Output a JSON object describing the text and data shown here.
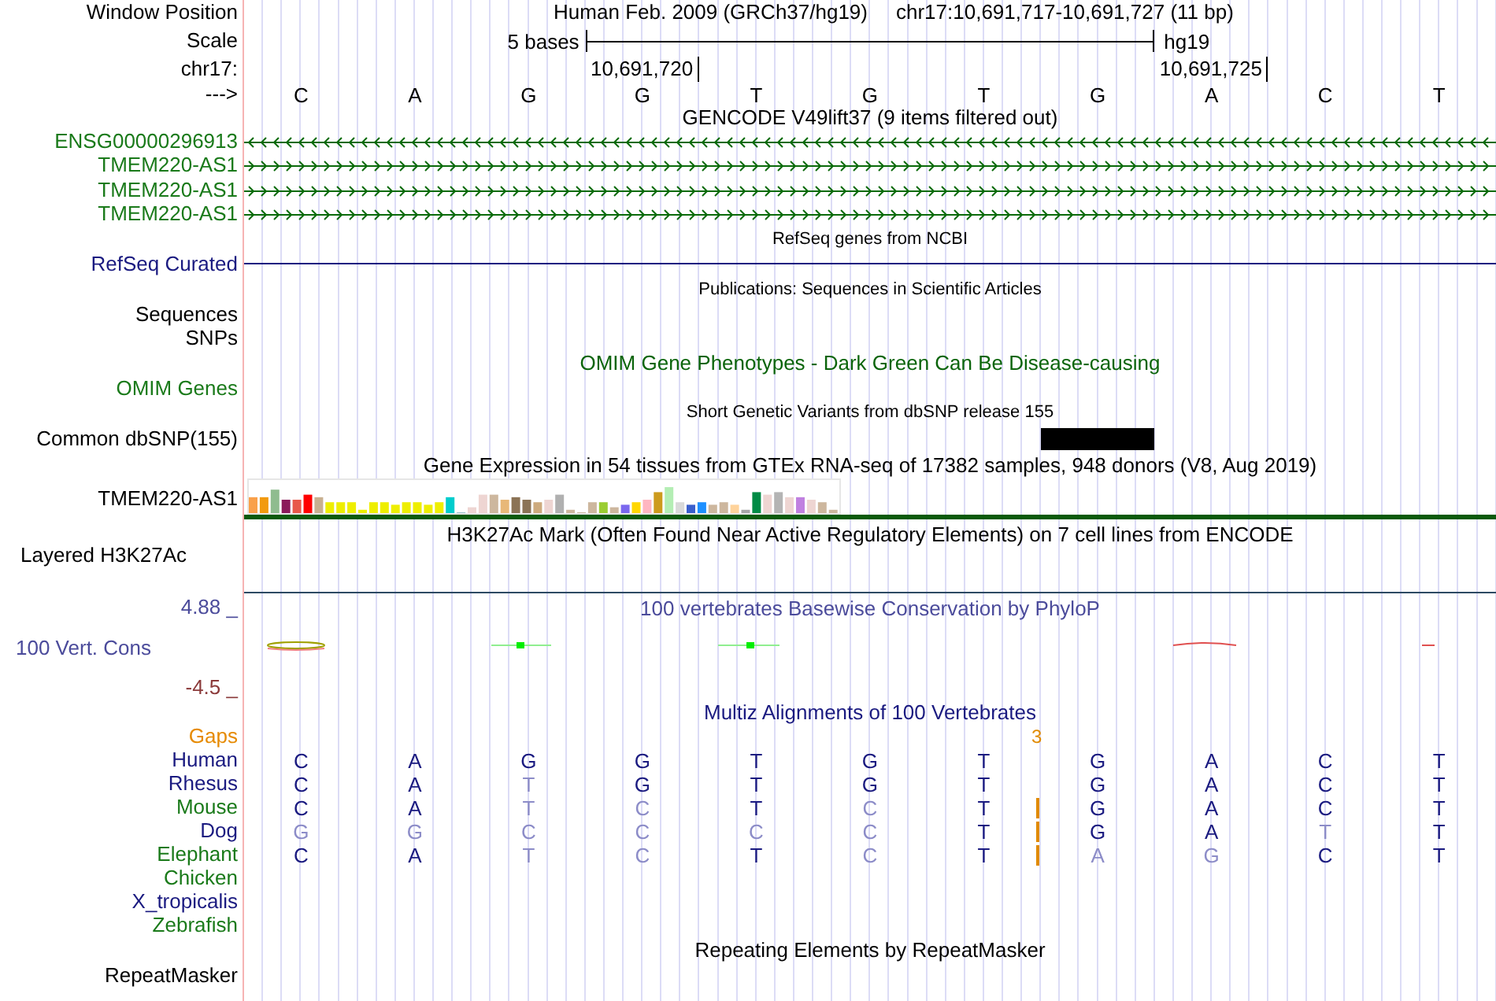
{
  "header": {
    "label": "Window Position",
    "title": "Human Feb. 2009 (GRCh37/hg19)",
    "position": "chr17:10,691,717-10,691,727 (11 bp)"
  },
  "scale": {
    "label": "Scale",
    "span": "5 bases",
    "assembly": "hg19"
  },
  "coordinates": {
    "label": "chr17:",
    "ticks": [
      "10,691,720",
      "10,691,725"
    ]
  },
  "sequence": {
    "label": "--->",
    "bases": [
      "C",
      "A",
      "G",
      "G",
      "T",
      "G",
      "T",
      "G",
      "A",
      "C",
      "T"
    ]
  },
  "gencode": {
    "title": "GENCODE V49lift37 (9 items filtered out)",
    "genes": [
      {
        "name": "ENSG00000296913",
        "reverse_strand": true
      },
      {
        "name": "TMEM220-AS1",
        "reverse_strand": false
      },
      {
        "name": "TMEM220-AS1",
        "reverse_strand": false
      },
      {
        "name": "TMEM220-AS1",
        "reverse_strand": false
      }
    ]
  },
  "refseq": {
    "title": "RefSeq genes from NCBI",
    "label": "RefSeq Curated"
  },
  "publications": {
    "title": "Publications: Sequences in Scientific Articles",
    "labels": [
      "Sequences",
      "SNPs"
    ]
  },
  "omim": {
    "title": "OMIM Gene Phenotypes - Dark Green Can Be Disease-causing",
    "label": "OMIM Genes"
  },
  "dbsnp": {
    "title": "Short Genetic Variants from dbSNP release 155",
    "label": "Common dbSNP(155)"
  },
  "gtex": {
    "title": "Gene Expression in 54 tissues from GTEx RNA-seq of 17382 samples, 948 donors (V8, Aug 2019)",
    "label": "TMEM220-AS1"
  },
  "h3k27ac": {
    "title": "H3K27Ac Mark (Often Found Near Active Regulatory Elements) on 7 cell lines from ENCODE",
    "label": "Layered H3K27Ac"
  },
  "phylop": {
    "title": "100 vertebrates Basewise Conservation by PhyloP",
    "label": "100 Vert. Cons",
    "max": "4.88 _",
    "min": "-4.5 _"
  },
  "multiz": {
    "title": "Multiz Alignments of 100 Vertebrates",
    "gaps": {
      "label": "Gaps",
      "count": "3"
    },
    "species": [
      {
        "name": "Human",
        "color": "#1a1a80",
        "gap": false,
        "bases": [
          {
            "base": "C",
            "faded": false
          },
          {
            "base": "A",
            "faded": false
          },
          {
            "base": "G",
            "faded": false
          },
          {
            "base": "G",
            "faded": false
          },
          {
            "base": "T",
            "faded": false
          },
          {
            "base": "G",
            "faded": false
          },
          {
            "base": "T",
            "faded": false
          },
          {
            "base": "G",
            "faded": false
          },
          {
            "base": "A",
            "faded": false
          },
          {
            "base": "C",
            "faded": false
          },
          {
            "base": "T",
            "faded": false
          }
        ]
      },
      {
        "name": "Rhesus",
        "color": "#1a1a80",
        "gap": false,
        "bases": [
          {
            "base": "C",
            "faded": false
          },
          {
            "base": "A",
            "faded": false
          },
          {
            "base": "T",
            "faded": true
          },
          {
            "base": "G",
            "faded": false
          },
          {
            "base": "T",
            "faded": false
          },
          {
            "base": "G",
            "faded": false
          },
          {
            "base": "T",
            "faded": false
          },
          {
            "base": "G",
            "faded": false
          },
          {
            "base": "A",
            "faded": false
          },
          {
            "base": "C",
            "faded": false
          },
          {
            "base": "T",
            "faded": false
          }
        ]
      },
      {
        "name": "Mouse",
        "color": "#1a7a1a",
        "gap": true,
        "bases": [
          {
            "base": "C",
            "faded": false
          },
          {
            "base": "A",
            "faded": false
          },
          {
            "base": "T",
            "faded": true
          },
          {
            "base": "C",
            "faded": true
          },
          {
            "base": "T",
            "faded": false
          },
          {
            "base": "C",
            "faded": true
          },
          {
            "base": "T",
            "faded": false
          },
          {
            "base": "G",
            "faded": false
          },
          {
            "base": "A",
            "faded": false
          },
          {
            "base": "C",
            "faded": false
          },
          {
            "base": "T",
            "faded": false
          }
        ]
      },
      {
        "name": "Dog",
        "color": "#1a1a80",
        "gap": true,
        "bases": [
          {
            "base": "G",
            "faded": true
          },
          {
            "base": "G",
            "faded": true
          },
          {
            "base": "C",
            "faded": true
          },
          {
            "base": "C",
            "faded": true
          },
          {
            "base": "C",
            "faded": true
          },
          {
            "base": "C",
            "faded": true
          },
          {
            "base": "T",
            "faded": false
          },
          {
            "base": "G",
            "faded": false
          },
          {
            "base": "A",
            "faded": false
          },
          {
            "base": "T",
            "faded": true
          },
          {
            "base": "T",
            "faded": false
          }
        ]
      },
      {
        "name": "Elephant",
        "color": "#1a7a1a",
        "gap": true,
        "bases": [
          {
            "base": "C",
            "faded": false
          },
          {
            "base": "A",
            "faded": false
          },
          {
            "base": "T",
            "faded": true
          },
          {
            "base": "C",
            "faded": true
          },
          {
            "base": "T",
            "faded": false
          },
          {
            "base": "C",
            "faded": true
          },
          {
            "base": "T",
            "faded": false
          },
          {
            "base": "A",
            "faded": true
          },
          {
            "base": "G",
            "faded": true
          },
          {
            "base": "C",
            "faded": false
          },
          {
            "base": "T",
            "faded": false
          }
        ]
      },
      {
        "name": "Chicken",
        "color": "#1a7a1a",
        "gap": false
      },
      {
        "name": "X_tropicalis",
        "color": "#1a1a80",
        "gap": false
      },
      {
        "name": "Zebrafish",
        "color": "#1a7a1a",
        "gap": false
      }
    ]
  },
  "repeatmasker": {
    "title": "Repeating Elements by RepeatMasker",
    "label": "RepeatMasker"
  }
}
